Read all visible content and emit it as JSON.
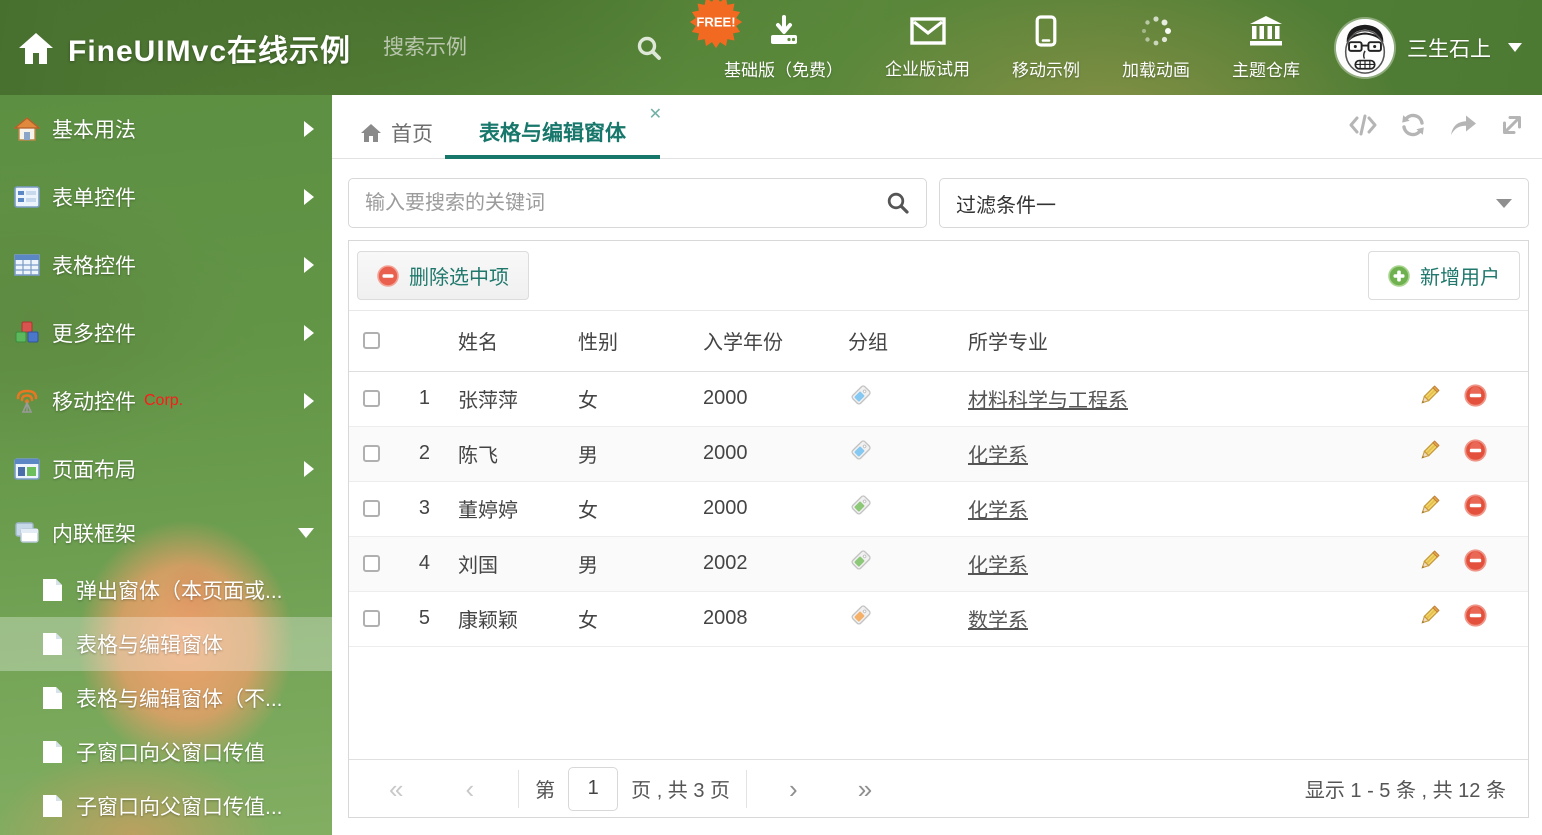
{
  "header": {
    "title": "FineUIMvc在线示例",
    "search_placeholder": "搜索示例",
    "free_badge": "FREE!",
    "nav": [
      {
        "label": "基础版（免费）",
        "icon": "download-icon"
      },
      {
        "label": "企业版试用",
        "icon": "envelope-icon"
      },
      {
        "label": "移动示例",
        "icon": "phone-icon"
      },
      {
        "label": "加载动画",
        "icon": "spinner-icon"
      },
      {
        "label": "主题仓库",
        "icon": "bank-icon"
      }
    ],
    "username": "三生石上"
  },
  "sidebar": {
    "items": [
      {
        "label": "基本用法"
      },
      {
        "label": "表单控件"
      },
      {
        "label": "表格控件"
      },
      {
        "label": "更多控件"
      },
      {
        "label": "移动控件",
        "badge": "Corp."
      },
      {
        "label": "页面布局"
      },
      {
        "label": "内联框架"
      }
    ],
    "subitems": [
      {
        "label": "弹出窗体（本页面或..."
      },
      {
        "label": "表格与编辑窗体"
      },
      {
        "label": "表格与编辑窗体（不..."
      },
      {
        "label": "子窗口向父窗口传值"
      },
      {
        "label": "子窗口向父窗口传值..."
      }
    ]
  },
  "tabs": {
    "home": "首页",
    "active": "表格与编辑窗体",
    "close": "✕"
  },
  "filters": {
    "search_placeholder": "输入要搜索的关键词",
    "dropdown_value": "过滤条件一"
  },
  "toolbar": {
    "delete_label": "删除选中项",
    "add_label": "新增用户"
  },
  "table": {
    "columns": {
      "name": "姓名",
      "gender": "性别",
      "year": "入学年份",
      "group": "分组",
      "major": "所学专业"
    },
    "rows": [
      {
        "index": "1",
        "name": "张萍萍",
        "gender": "女",
        "year": "2000",
        "tag_color": "#85c8f2",
        "major": "材料科学与工程系"
      },
      {
        "index": "2",
        "name": "陈飞",
        "gender": "男",
        "year": "2000",
        "tag_color": "#85c8f2",
        "major": "化学系"
      },
      {
        "index": "3",
        "name": "董婷婷",
        "gender": "女",
        "year": "2000",
        "tag_color": "#8dc878",
        "major": "化学系"
      },
      {
        "index": "4",
        "name": "刘国",
        "gender": "男",
        "year": "2002",
        "tag_color": "#8dc878",
        "major": "化学系"
      },
      {
        "index": "5",
        "name": "康颖颖",
        "gender": "女",
        "year": "2008",
        "tag_color": "#f5b06a",
        "major": "数学系"
      }
    ]
  },
  "pagination": {
    "first": "«",
    "prev": "‹",
    "next": "›",
    "last": "»",
    "page_prefix": "第",
    "page_value": "1",
    "page_suffix": "页 , 共 3 页",
    "summary": "显示 1 - 5 条 , 共 12 条"
  },
  "colors": {
    "accent_teal": "#17776b",
    "header_green": "#5d8c3d",
    "free_badge_orange": "#f26a21",
    "delete_red": "#dd4a35",
    "add_green": "#62a544",
    "tag_blue": "#85c8f2",
    "tag_green": "#8dc878",
    "tag_orange": "#f5b06a"
  }
}
